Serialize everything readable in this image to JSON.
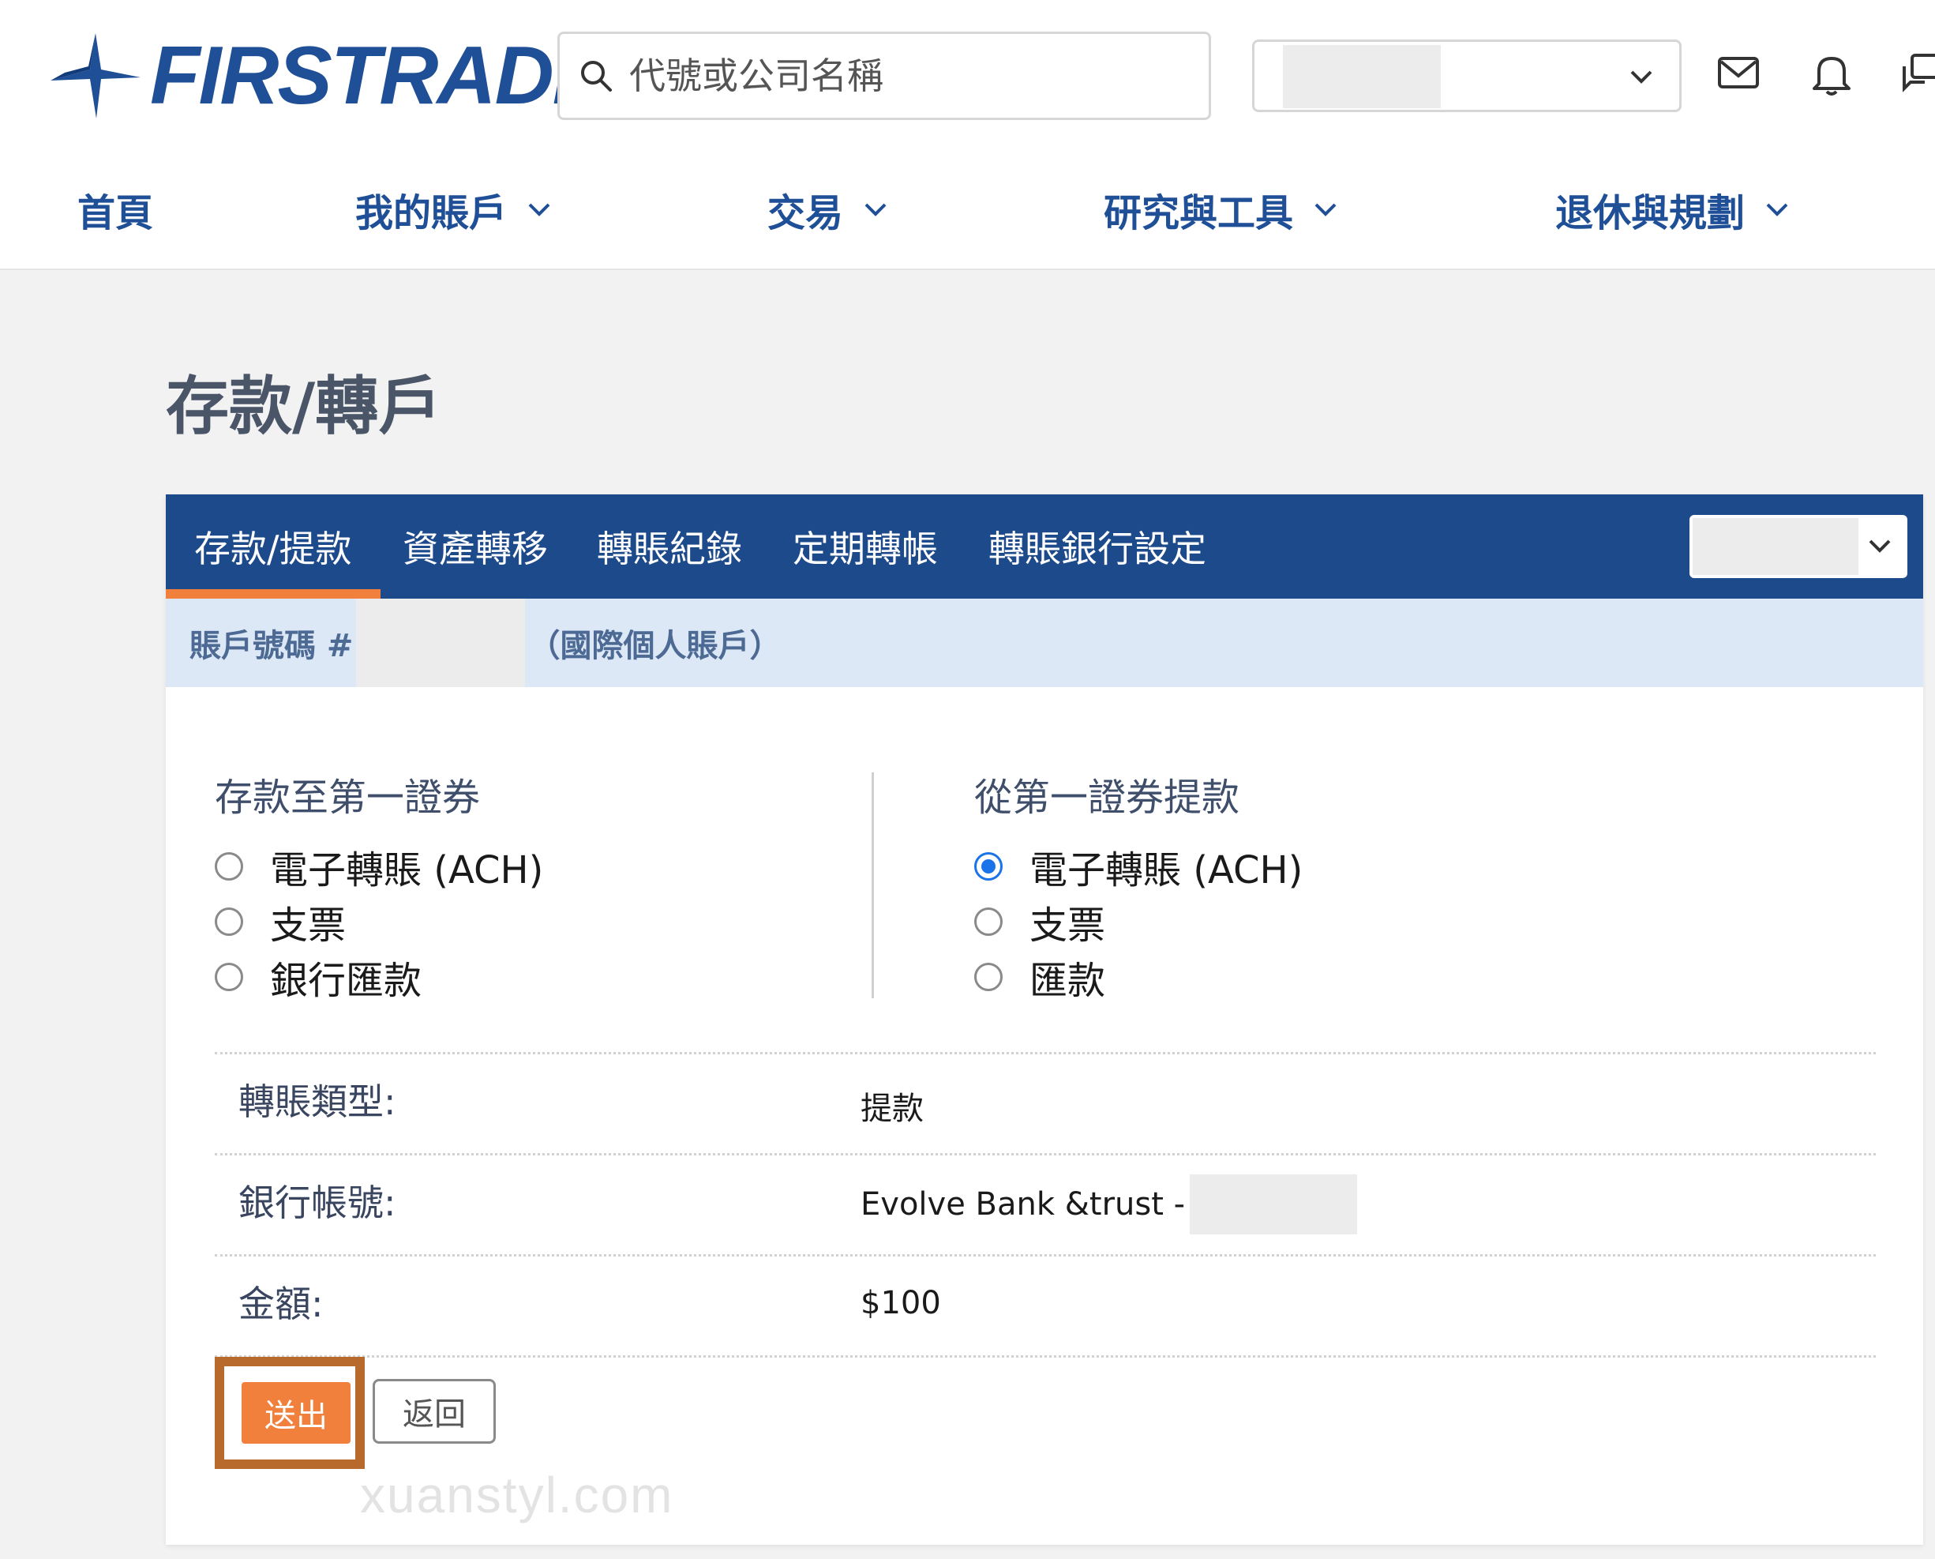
{
  "header": {
    "logo_text": "FIRSTRADE",
    "search_placeholder": "代號或公司名稱"
  },
  "nav": {
    "items": [
      {
        "label": "首頁"
      },
      {
        "label": "我的賬戶"
      },
      {
        "label": "交易"
      },
      {
        "label": "研究與工具"
      },
      {
        "label": "退休與規劃"
      }
    ]
  },
  "page": {
    "title": "存款/轉戶"
  },
  "tabs": [
    {
      "label": "存款/提款",
      "active": true
    },
    {
      "label": "資產轉移"
    },
    {
      "label": "轉賬紀錄"
    },
    {
      "label": "定期轉帳"
    },
    {
      "label": "轉賬銀行設定"
    }
  ],
  "account_strip": {
    "prefix": "賬戶號碼 #",
    "suffix": "（國際個人賬戶）"
  },
  "deposit": {
    "title": "存款至第一證券",
    "options": [
      {
        "label": "電子轉賬 (ACH)",
        "checked": false
      },
      {
        "label": "支票",
        "checked": false
      },
      {
        "label": "銀行匯款",
        "checked": false
      }
    ]
  },
  "withdraw": {
    "title": "從第一證券提款",
    "options": [
      {
        "label": "電子轉賬 (ACH)",
        "checked": true
      },
      {
        "label": "支票",
        "checked": false
      },
      {
        "label": "匯款",
        "checked": false
      }
    ]
  },
  "details": {
    "type_label": "轉賬類型:",
    "type_value": "提款",
    "bank_label": "銀行帳號:",
    "bank_value": "Evolve Bank &trust -",
    "amount_label": "金額:",
    "amount_value": "$100"
  },
  "buttons": {
    "submit": "送出",
    "back": "返回"
  },
  "watermark": "xuanstyl.com",
  "colors": {
    "brand_blue": "#1f4f96",
    "tab_bar": "#1d4a8a",
    "accent_orange": "#f0803c",
    "highlight_border": "#b8692c"
  }
}
